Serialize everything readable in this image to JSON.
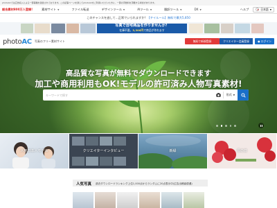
{
  "notice": "photoACでは広告収入による一部事業を運営されております。この記事ページを通じてphotoACをご利用いただいた方に、一部の手数料を頂戴する場合があります。",
  "navbar": {
    "count_label": "総合素材800万人登録!",
    "items": [
      "素材サイト",
      "ファイル転送",
      "デザインツール",
      "AIツール",
      "翻訳ツール",
      "DX"
    ],
    "help": "ヘルプ",
    "language": "日本語"
  },
  "promo": {
    "text_before": "このチャンスを逃して...正常でいられますか？",
    "highlight": "【チイルール】無料で最大5,850",
    "text_after": ""
  },
  "ad": {
    "line1": "写真で自宅商品を作りませんか？",
    "line2_prefix": "在庫不要。",
    "line2_highlight": "3,300円",
    "line2_suffix": "で商品が作れます"
  },
  "header": {
    "logo_main": "photo",
    "logo_accent": "AC",
    "tagline": "写真のフリー素材サイト",
    "register": "無料で新規登録",
    "creator": "クリエイター会員登録",
    "login": "ログイン"
  },
  "hero": {
    "line1": "高品質な写真が無料でダウンロードできます",
    "line2": "加工や商用利用もOK!モデルの許可済み人物写真素材!",
    "search_placeholder": "キーワードで探す",
    "filter_label": "形式",
    "dots": 5,
    "active_dot": 1
  },
  "categories": [
    {
      "label": "人気日本人モデル"
    },
    {
      "label": "クリエイターインタビュー"
    },
    {
      "label": "新緑"
    },
    {
      "label": "母の日"
    }
  ],
  "ranking": {
    "title": "人気写真",
    "subtitle": "過去ダウンロードランキング上位1,000点からランダムに20点表示中(広告出稿者優遇)"
  },
  "colors": {
    "brand_blue": "#1a6fc8",
    "register_red": "#e23a3a",
    "creator_blue": "#1a5aa8"
  }
}
